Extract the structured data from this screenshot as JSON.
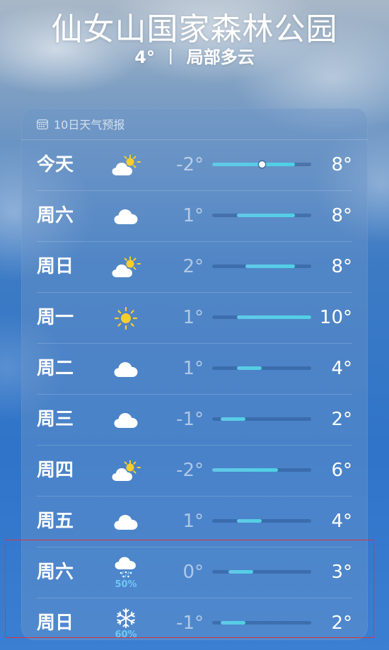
{
  "header": {
    "location": "仙女山国家森林公园",
    "temperature": "4°",
    "separator": "丨",
    "condition": "局部多云"
  },
  "forecast": {
    "title": "10日天气预报",
    "range_min": -2,
    "range_max": 10,
    "current_temp": 4,
    "days": [
      {
        "day": "今天",
        "icon": "partly-cloudy-day-icon",
        "low": "-2°",
        "high": "8°",
        "low_value": -2,
        "high_value": 8,
        "show_current": true,
        "precip": ""
      },
      {
        "day": "周六",
        "icon": "cloud-icon",
        "low": "1°",
        "high": "8°",
        "low_value": 1,
        "high_value": 8,
        "show_current": false,
        "precip": ""
      },
      {
        "day": "周日",
        "icon": "partly-cloudy-day-icon",
        "low": "2°",
        "high": "8°",
        "low_value": 2,
        "high_value": 8,
        "show_current": false,
        "precip": ""
      },
      {
        "day": "周一",
        "icon": "sun-icon",
        "low": "1°",
        "high": "10°",
        "low_value": 1,
        "high_value": 10,
        "show_current": false,
        "precip": ""
      },
      {
        "day": "周二",
        "icon": "cloud-icon",
        "low": "1°",
        "high": "4°",
        "low_value": 1,
        "high_value": 4,
        "show_current": false,
        "precip": ""
      },
      {
        "day": "周三",
        "icon": "cloud-icon",
        "low": "-1°",
        "high": "2°",
        "low_value": -1,
        "high_value": 2,
        "show_current": false,
        "precip": ""
      },
      {
        "day": "周四",
        "icon": "partly-cloudy-day-icon",
        "low": "-2°",
        "high": "6°",
        "low_value": -2,
        "high_value": 6,
        "show_current": false,
        "precip": ""
      },
      {
        "day": "周五",
        "icon": "cloud-icon",
        "low": "1°",
        "high": "4°",
        "low_value": 1,
        "high_value": 4,
        "show_current": false,
        "precip": ""
      },
      {
        "day": "周六",
        "icon": "sleet-icon",
        "low": "0°",
        "high": "3°",
        "low_value": 0,
        "high_value": 3,
        "show_current": false,
        "precip": "50%"
      },
      {
        "day": "周日",
        "icon": "snowflake-icon",
        "low": "-1°",
        "high": "2°",
        "low_value": -1,
        "high_value": 2,
        "show_current": false,
        "precip": "60%"
      }
    ]
  },
  "colors": {
    "precip_text": "#6ec8f5",
    "bar_fill": "#5ccbe6",
    "sun": "#f8cd2c",
    "highlight_border": "#d9363e"
  }
}
